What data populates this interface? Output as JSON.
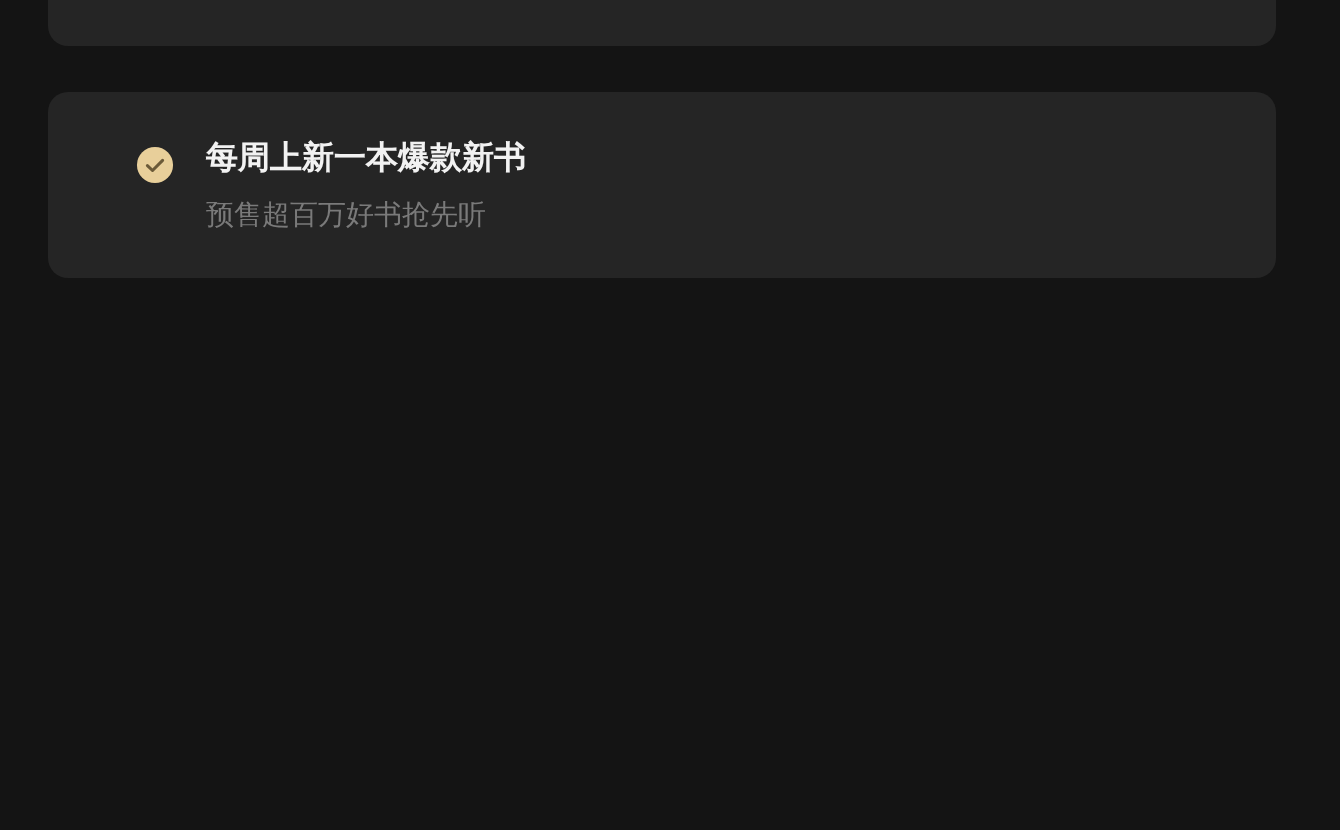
{
  "benefits": [
    {
      "title": "每周上新一本爆款新书",
      "subtitle": "预售超百万好书抢先听",
      "checked": true
    }
  ]
}
